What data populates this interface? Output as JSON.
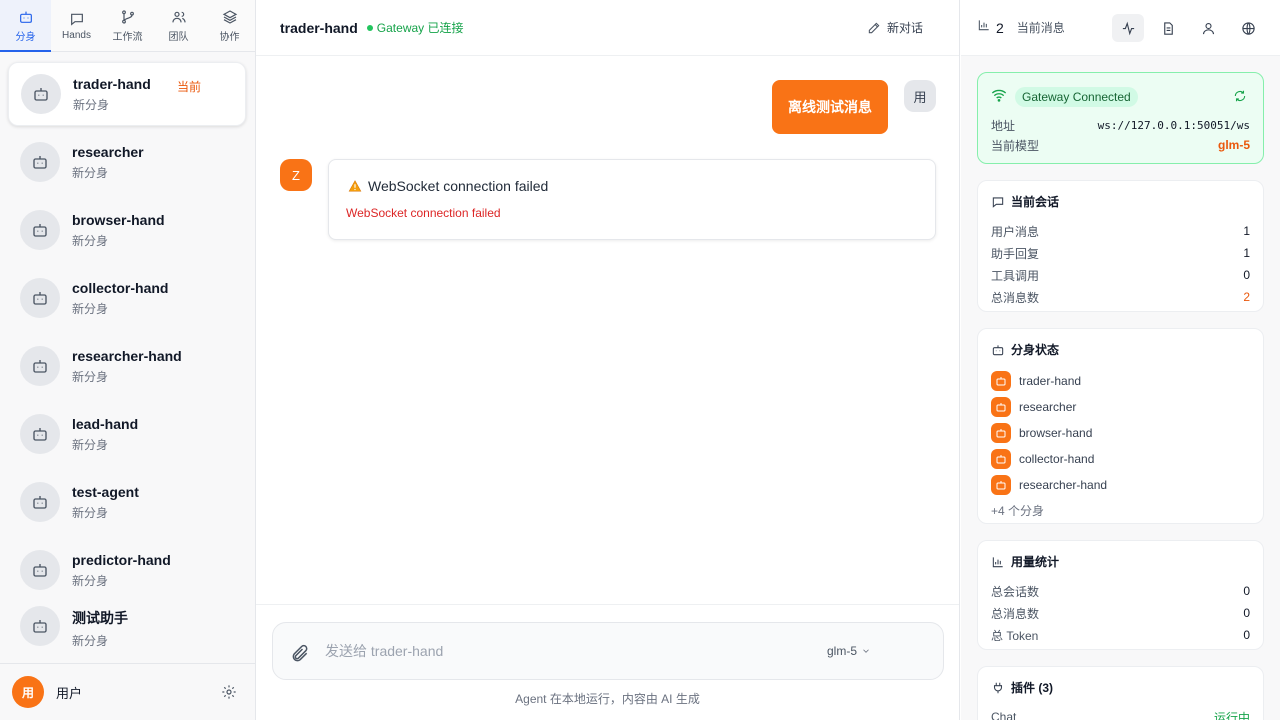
{
  "nav": {
    "tabs": [
      {
        "label": "分身",
        "icon": "bot-icon",
        "active": true
      },
      {
        "label": "Hands",
        "icon": "message-square-icon"
      },
      {
        "label": "工作流",
        "icon": "git-branch-icon"
      },
      {
        "label": "团队",
        "icon": "users-icon"
      },
      {
        "label": "协作",
        "icon": "layers-icon"
      }
    ]
  },
  "agents": [
    {
      "name": "trader-hand",
      "sub": "新分身",
      "badge": "当前"
    },
    {
      "name": "researcher",
      "sub": "新分身"
    },
    {
      "name": "browser-hand",
      "sub": "新分身"
    },
    {
      "name": "collector-hand",
      "sub": "新分身"
    },
    {
      "name": "researcher-hand",
      "sub": "新分身"
    },
    {
      "name": "lead-hand",
      "sub": "新分身"
    },
    {
      "name": "test-agent",
      "sub": "新分身"
    },
    {
      "name": "predictor-hand",
      "sub": "新分身"
    },
    {
      "name": "测试助手",
      "sub": "新分身"
    }
  ],
  "user": {
    "avatar": "用",
    "name": "用户"
  },
  "header": {
    "title": "trader-hand",
    "gateway_status": "Gateway 已连接",
    "new_chat": "新对话"
  },
  "chat": {
    "user_message": "离线测试消息",
    "user_avatar": "用",
    "bot_avatar": "Z",
    "bot_title": "WebSocket connection failed",
    "bot_detail": "WebSocket connection failed"
  },
  "composer": {
    "placeholder": "发送给 trader-hand",
    "model": "glm-5",
    "footer": "Agent 在本地运行，内容由 AI 生成"
  },
  "right": {
    "count": "2",
    "label": "当前消息",
    "gateway": {
      "status": "Gateway Connected",
      "address_label": "地址",
      "address": "ws://127.0.0.1:50051/ws",
      "model_label": "当前模型",
      "model": "glm-5"
    },
    "session": {
      "title": "当前会话",
      "rows": [
        {
          "label": "用户消息",
          "value": "1"
        },
        {
          "label": "助手回复",
          "value": "1"
        },
        {
          "label": "工具调用",
          "value": "0"
        },
        {
          "label": "总消息数",
          "value": "2"
        }
      ]
    },
    "agent_status": {
      "title": "分身状态",
      "items": [
        "trader-hand",
        "researcher",
        "browser-hand",
        "collector-hand",
        "researcher-hand"
      ],
      "more": "+4 个分身"
    },
    "usage": {
      "title": "用量统计",
      "rows": [
        {
          "label": "总会话数",
          "value": "0"
        },
        {
          "label": "总消息数",
          "value": "0"
        },
        {
          "label": "总 Token",
          "value": "0"
        }
      ]
    },
    "plugins": {
      "title": "插件 (3)",
      "rows": [
        {
          "label": "Chat",
          "value": "运行中"
        }
      ]
    }
  },
  "colors": {
    "accent": "#f97316",
    "primary": "#2563eb",
    "success": "#16a34a",
    "error": "#dc2626"
  }
}
